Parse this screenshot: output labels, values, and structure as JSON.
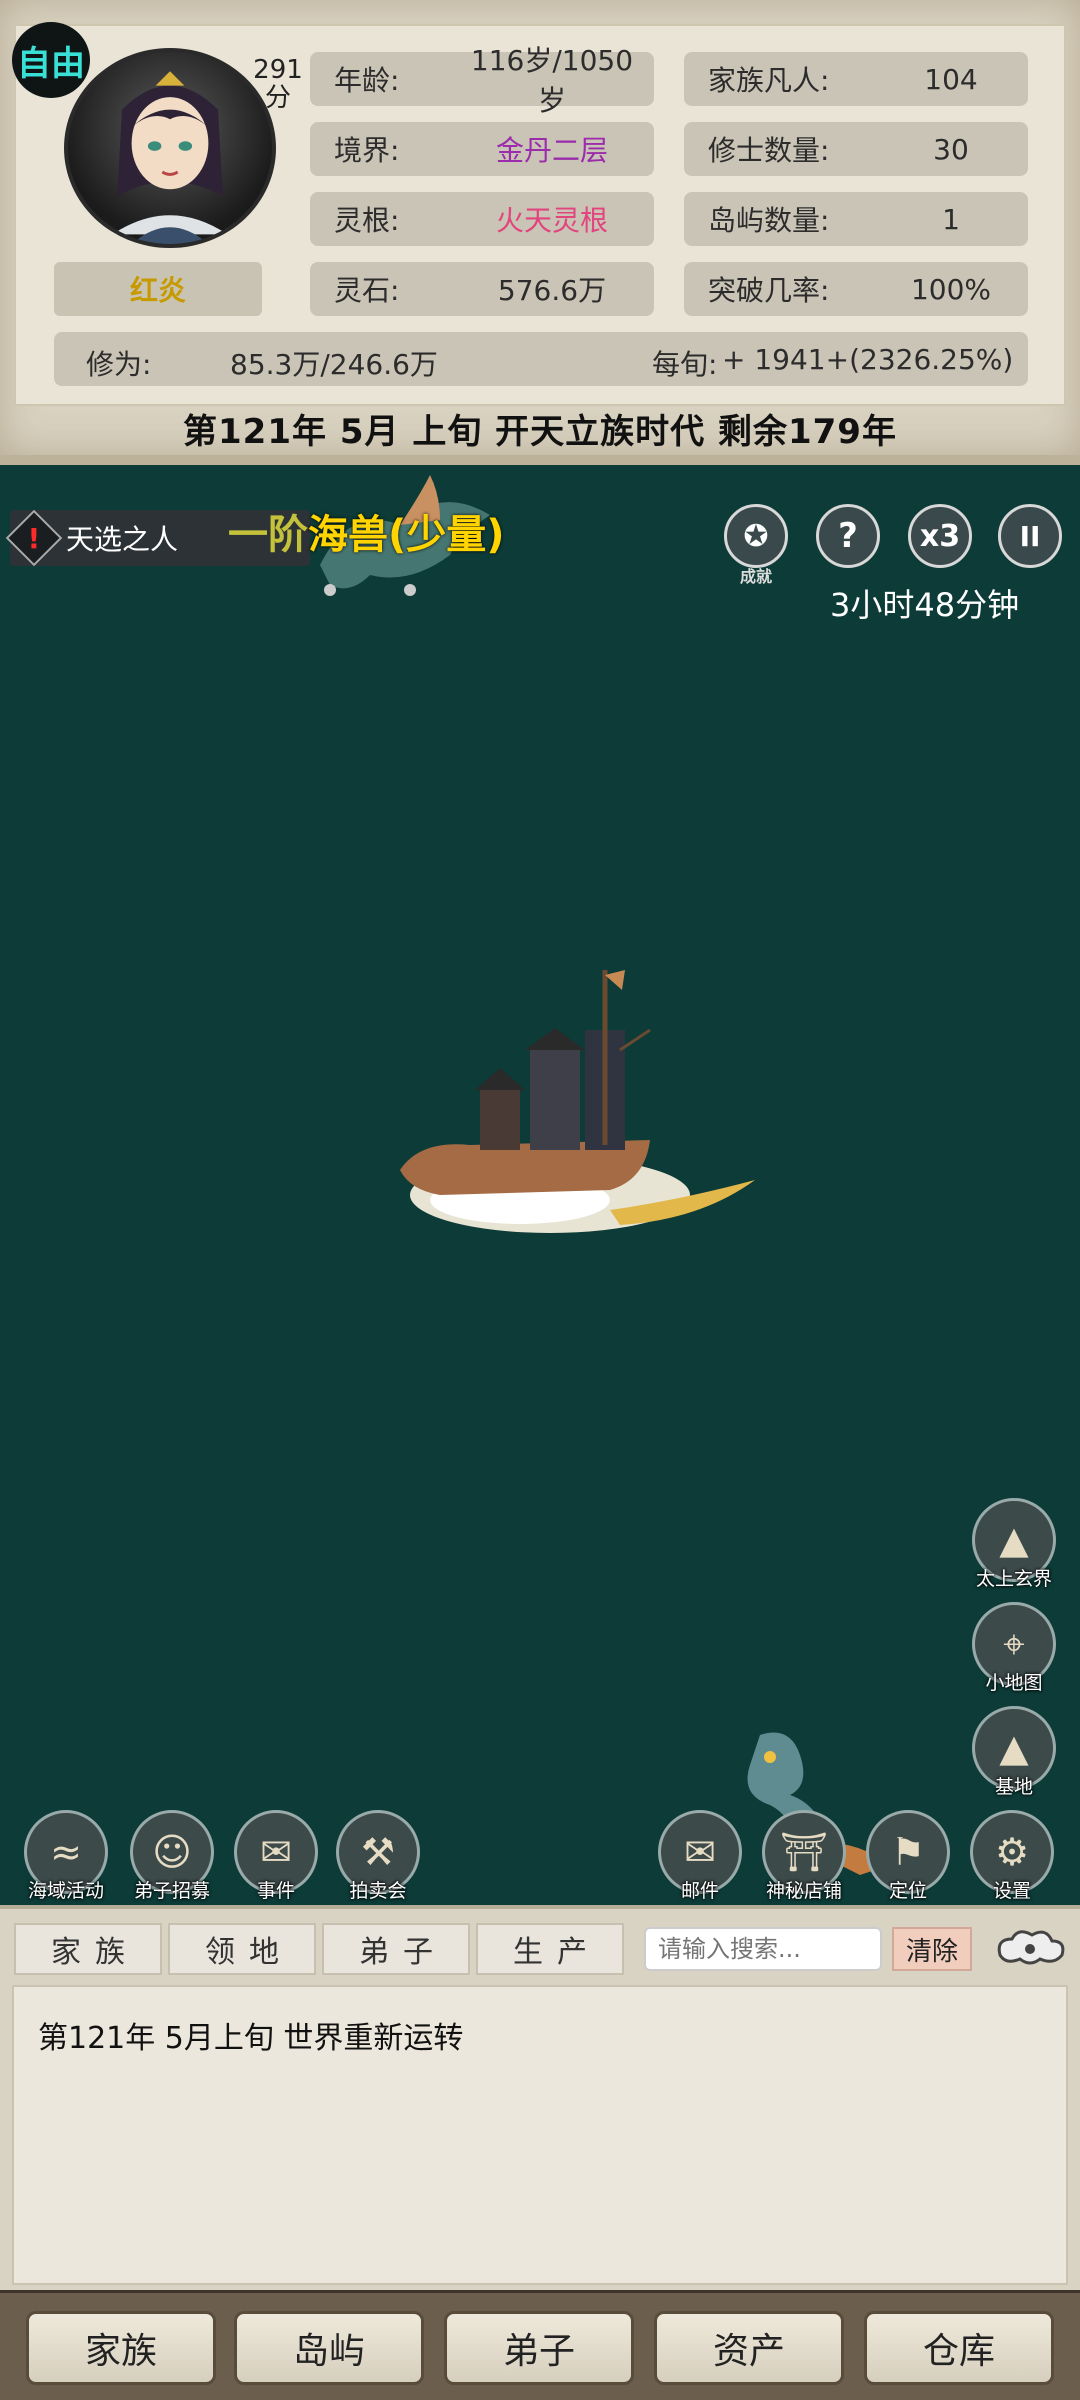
{
  "header": {
    "mode_badge": "自由",
    "score_value": "291",
    "score_unit": "分",
    "name": "红炎",
    "stats_left": [
      {
        "key": "年龄:",
        "value": "116岁/1050岁"
      },
      {
        "key": "境界:",
        "value": "金丹二层"
      },
      {
        "key": "灵根:",
        "value": "火天灵根"
      },
      {
        "key": "灵石:",
        "value": "576.6万"
      }
    ],
    "stats_right": [
      {
        "key": "家族凡人:",
        "value": "104"
      },
      {
        "key": "修士数量:",
        "value": "30"
      },
      {
        "key": "岛屿数量:",
        "value": "1"
      },
      {
        "key": "突破几率:",
        "value": "100%"
      }
    ],
    "cultivation_key": "修为:",
    "cultivation_value": "85.3万/246.6万",
    "per_period_key": "每旬:",
    "per_period_value": "+ 1941+(2326.25%)",
    "date_line": "第121年 5月 上旬  开天立族时代 剩余179年",
    "colors": {
      "realm": "#9b2cab",
      "root": "#e2447d",
      "name": "#c69a00"
    }
  },
  "map": {
    "event_tag": "天选之人",
    "beast_level": "一阶",
    "beast_name": "海兽(少量)",
    "achievement_label": "成就",
    "help_icon": "?",
    "speed_label": "x3",
    "pause_icon": "II",
    "timer": "3小时48分钟",
    "right_buttons": [
      {
        "label": "太上玄界",
        "icon": "mountain-icon"
      },
      {
        "label": "小地图",
        "icon": "map-pin-icon"
      },
      {
        "label": "基地",
        "icon": "mountain-base-icon"
      }
    ],
    "bottom_left_buttons": [
      {
        "label": "海域活动",
        "icon": "wave-icon"
      },
      {
        "label": "弟子招募",
        "icon": "disciple-icon"
      },
      {
        "label": "事件",
        "icon": "scroll-icon"
      },
      {
        "label": "拍卖会",
        "icon": "hammer-icon"
      }
    ],
    "bottom_right_buttons": [
      {
        "label": "邮件",
        "icon": "mail-icon"
      },
      {
        "label": "神秘店铺",
        "icon": "shop-icon"
      },
      {
        "label": "定位",
        "icon": "flag-icon"
      },
      {
        "label": "设置",
        "icon": "gear-icon"
      }
    ]
  },
  "log": {
    "tabs": [
      "家族",
      "领地",
      "弟子",
      "生产"
    ],
    "search_placeholder": "请输入搜索...",
    "clear_label": "清除",
    "entries": [
      "第121年   5月上旬 世界重新运转"
    ]
  },
  "nav": [
    "家族",
    "岛屿",
    "弟子",
    "资产",
    "仓库"
  ]
}
